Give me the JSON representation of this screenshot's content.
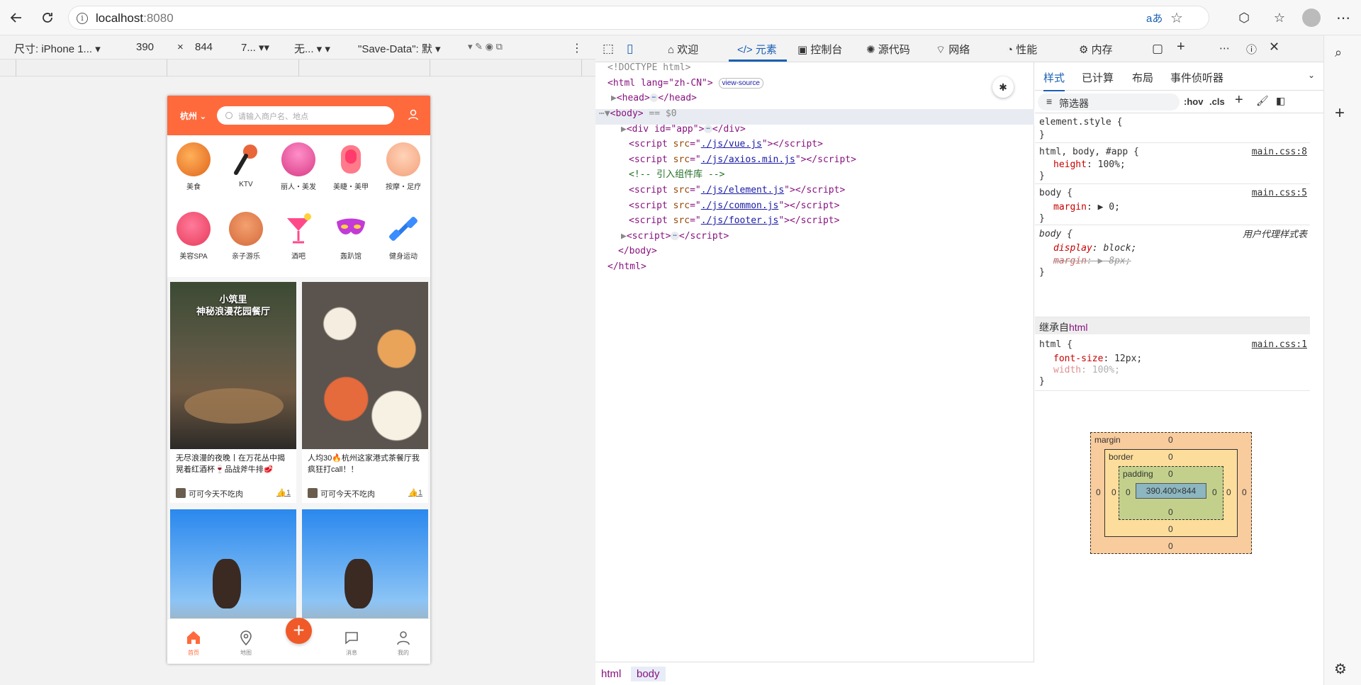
{
  "browser": {
    "url_host": "localhost",
    "url_port": ":8080"
  },
  "device_toolbar": {
    "device": "尺寸: iPhone 1...",
    "width": "390",
    "times": "×",
    "height": "844",
    "zoom": "7...",
    "throttle": "无...",
    "save_data": "\"Save-Data\": 默"
  },
  "phone": {
    "city": "杭州",
    "search_placeholder": "请输入商户名、地点",
    "categories": [
      {
        "label": "美食",
        "icon": "roast-chicken-icon"
      },
      {
        "label": "KTV",
        "icon": "microphone-icon"
      },
      {
        "label": "丽人・美发",
        "icon": "hair-icon"
      },
      {
        "label": "美睫・美甲",
        "icon": "nail-icon"
      },
      {
        "label": "按摩・足疗",
        "icon": "massage-icon"
      },
      {
        "label": "美容SPA",
        "icon": "face-mask-icon"
      },
      {
        "label": "亲子游乐",
        "icon": "parent-child-icon"
      },
      {
        "label": "酒吧",
        "icon": "cocktail-icon"
      },
      {
        "label": "轰趴馆",
        "icon": "party-mask-icon"
      },
      {
        "label": "健身运动",
        "icon": "dumbbell-icon"
      }
    ],
    "cards": [
      {
        "img_title": "小筑里\n神秘浪漫花园餐厅",
        "caption": "无尽浪漫的夜晚丨在万花丛中揭晃着红酒杯🍷品战斧牛排🥩",
        "author": "可可今天不吃肉",
        "likes": "1"
      },
      {
        "img_title": "",
        "caption": "人均30🔥杭州这家港式茶餐厅我疯狂打call！！",
        "author": "可可今天不吃肉",
        "likes": "1"
      },
      {
        "img_title": "",
        "caption": "",
        "author": "",
        "likes": ""
      },
      {
        "img_title": "",
        "caption": "",
        "author": "",
        "likes": ""
      }
    ],
    "tabs": [
      {
        "label": "首页"
      },
      {
        "label": "地图"
      },
      {
        "label": "消息"
      },
      {
        "label": "我的"
      }
    ],
    "plus": "+"
  },
  "devtools": {
    "tabs": [
      "欢迎",
      "元素",
      "控制台",
      "源代码",
      "网络",
      "性能",
      "内存"
    ],
    "dom": [
      "<!DOCTYPE html>",
      "<html lang=\"zh-CN\">",
      "view-source",
      "<head>",
      "</head>",
      "<body>",
      "== $0",
      "<div id=\"app\">",
      "</div>",
      "./js/vue.js",
      "./js/axios.min.js",
      "<!-- 引入组件库 -->",
      "./js/element.js",
      "./js/common.js",
      "./js/footer.js",
      "<script>",
      "</body>",
      "</html>"
    ],
    "crumbs": [
      "html",
      "body"
    ],
    "style_tabs": [
      "样式",
      "已计算",
      "布局",
      "事件侦听器"
    ],
    "filter_placeholder": "筛选器",
    "hov": ":hov",
    "cls": ".cls",
    "rules": {
      "element_style": "element.style {",
      "r1_sel": "html, body, #app {",
      "r1_src": "main.css:8",
      "r1_prop": "height",
      "r1_val": "100%;",
      "r2_sel": "body {",
      "r2_src": "main.css:5",
      "r2_prop": "margin",
      "r2_val": "0;",
      "r3_sel": "body {",
      "r3_src": "用户代理样式表",
      "r3_p1": "display",
      "r3_v1": "block;",
      "r3_p2": "margin",
      "r3_v2": "8px;",
      "inherit_label": "继承自",
      "inherit_tag": "html",
      "r4_sel": "html {",
      "r4_src": "main.css:1",
      "r4_p1": "font-size",
      "r4_v1": "12px;",
      "r4_p2": "width",
      "r4_v2": "100%;"
    },
    "boxmodel": {
      "margin": "margin",
      "border": "border",
      "padding": "padding",
      "content": "390.400×844",
      "zero": "0"
    }
  },
  "colors": {
    "brand": "#ff6a3d",
    "devtools_accent": "#1a5fb4"
  }
}
